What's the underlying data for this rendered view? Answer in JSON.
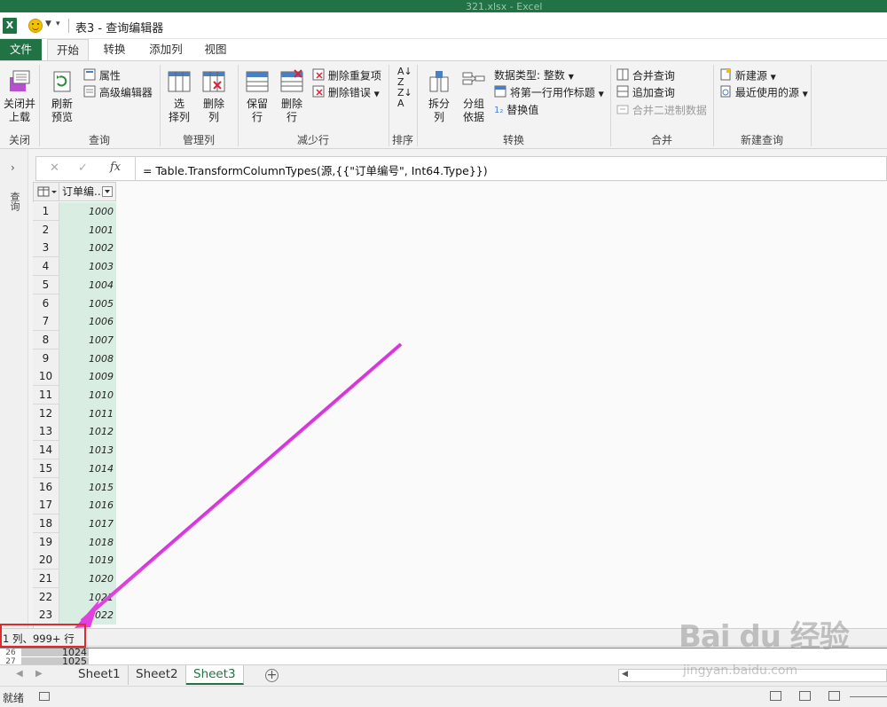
{
  "window": {
    "title": "表3 - 查询编辑器",
    "bg_title": "321.xlsx - Excel",
    "excel_icon": "excel-icon"
  },
  "tabs": [
    {
      "label": "文件"
    },
    {
      "label": "开始"
    },
    {
      "label": "转换"
    },
    {
      "label": "添加列"
    },
    {
      "label": "视图"
    }
  ],
  "ribbon": {
    "close": {
      "button": "关闭并\n上载",
      "group": "关闭"
    },
    "query": {
      "refresh": "刷新\n预览",
      "properties": "属性",
      "advanced_editor": "高级编辑器",
      "group": "查询"
    },
    "manage_cols": {
      "choose": "选\n择列",
      "remove": "删除\n列",
      "group": "管理列"
    },
    "reduce_rows": {
      "keep": "保留\n行",
      "remove": "删除\n行",
      "remove_dup": "删除重复项",
      "remove_err": "删除错误",
      "group": "减少行"
    },
    "sort": {
      "group": "排序"
    },
    "transform": {
      "split": "拆分\n列",
      "group_by": "分组\n依据",
      "data_type": "数据类型: 整数",
      "first_row": "将第一行用作标题",
      "replace": "替换值",
      "group": "转换"
    },
    "combine": {
      "merge": "合并查询",
      "append": "追加查询",
      "binary": "合并二进制数据",
      "group": "合并"
    },
    "new_query": {
      "new_source": "新建源",
      "recent": "最近使用的源",
      "group": "新建查询"
    }
  },
  "nav": {
    "label": "查询"
  },
  "formula": {
    "text": "= Table.TransformColumnTypes(源,{{\"订单编号\", Int64.Type}})",
    "fx": "fx"
  },
  "grid": {
    "column_header": "订单编...",
    "rows": [
      {
        "n": "1",
        "v": "1000"
      },
      {
        "n": "2",
        "v": "1001"
      },
      {
        "n": "3",
        "v": "1002"
      },
      {
        "n": "4",
        "v": "1003"
      },
      {
        "n": "5",
        "v": "1004"
      },
      {
        "n": "6",
        "v": "1005"
      },
      {
        "n": "7",
        "v": "1006"
      },
      {
        "n": "8",
        "v": "1007"
      },
      {
        "n": "9",
        "v": "1008"
      },
      {
        "n": "10",
        "v": "1009"
      },
      {
        "n": "11",
        "v": "1010"
      },
      {
        "n": "12",
        "v": "1011"
      },
      {
        "n": "13",
        "v": "1012"
      },
      {
        "n": "14",
        "v": "1013"
      },
      {
        "n": "15",
        "v": "1014"
      },
      {
        "n": "16",
        "v": "1015"
      },
      {
        "n": "17",
        "v": "1016"
      },
      {
        "n": "18",
        "v": "1017"
      },
      {
        "n": "19",
        "v": "1018"
      },
      {
        "n": "20",
        "v": "1019"
      },
      {
        "n": "21",
        "v": "1020"
      },
      {
        "n": "22",
        "v": "1021"
      },
      {
        "n": "23",
        "v": "1022"
      }
    ]
  },
  "query_status": "1 列、999+ 行",
  "peek": {
    "rows": [
      {
        "n": "26",
        "v": "1024"
      },
      {
        "n": "27",
        "v": "1025"
      }
    ]
  },
  "sheets": [
    {
      "label": "Sheet1",
      "active": false
    },
    {
      "label": "Sheet2",
      "active": false
    },
    {
      "label": "Sheet3",
      "active": true
    }
  ],
  "statusbar": {
    "ready": "就绪"
  },
  "watermark": {
    "brand": "Bai du 经验",
    "url": "jingyan.baidu.com"
  },
  "colors": {
    "excel_green": "#217346",
    "selected_column": "#d9ede2",
    "annotation_arrow": "#e040e0",
    "annotation_box": "#e12b2b"
  }
}
